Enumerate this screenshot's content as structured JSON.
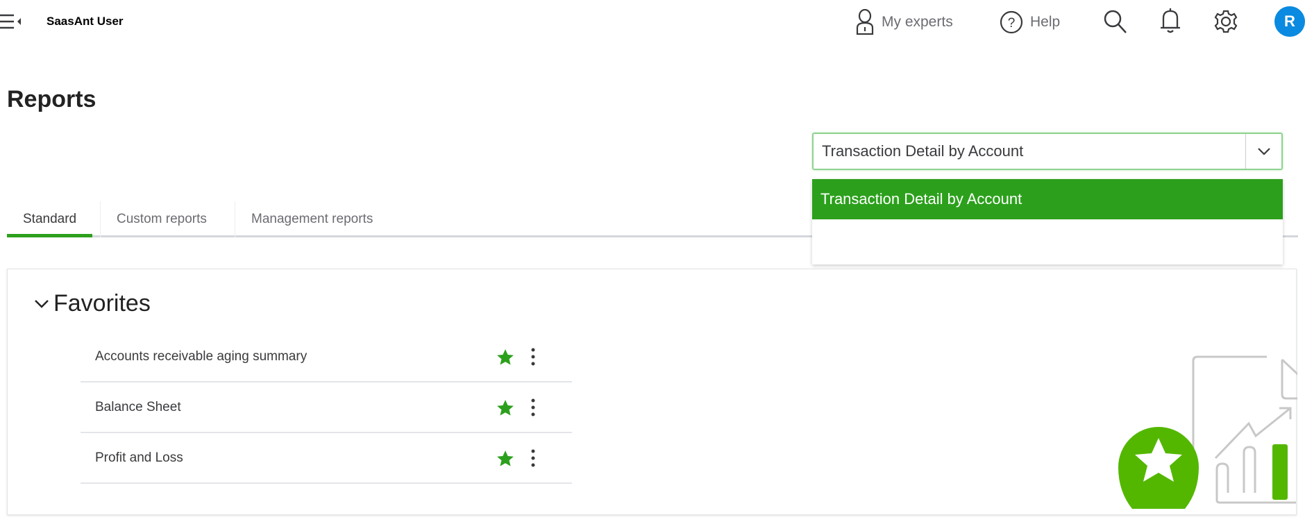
{
  "header": {
    "user_name": "SaasAnt User",
    "my_experts": "My experts",
    "help": "Help",
    "avatar_initial": "R"
  },
  "page": {
    "title": "Reports"
  },
  "search": {
    "value": "Transaction Detail by Account",
    "suggestions": [
      "Transaction Detail by Account"
    ]
  },
  "tabs": [
    {
      "label": "Standard",
      "active": true
    },
    {
      "label": "Custom reports"
    },
    {
      "label": "Management reports"
    }
  ],
  "favorites": {
    "title": "Favorites",
    "items": [
      {
        "label": "Accounts receivable aging summary",
        "favorited": true
      },
      {
        "label": "Balance Sheet",
        "favorited": true
      },
      {
        "label": "Profit and Loss",
        "favorited": true
      }
    ]
  },
  "colors": {
    "accent": "#2ca01c",
    "avatar": "#0a8ae0",
    "illustration_green": "#53b700"
  }
}
